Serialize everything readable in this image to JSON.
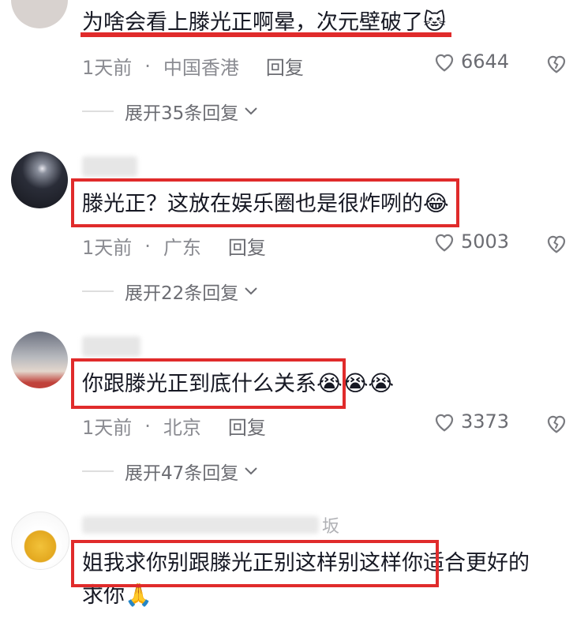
{
  "comments": [
    {
      "text_lines": [
        "为啥会看上滕光正啊晕，次元壁破了"
      ],
      "emoji": "🐱",
      "time": "1天前",
      "location": "中国香港",
      "reply_label": "回复",
      "likes": "6644",
      "expand_label": "展开35条回复"
    },
    {
      "text_lines": [
        "滕光正？这放在娱乐圈也是很炸咧的"
      ],
      "emoji": "😂",
      "time": "1天前",
      "location": "广东",
      "reply_label": "回复",
      "likes": "5003",
      "expand_label": "展开22条回复"
    },
    {
      "text_lines": [
        "你跟滕光正到底什么关系"
      ],
      "emoji": "😭😭😭",
      "time": "1天前",
      "location": "北京",
      "reply_label": "回复",
      "likes": "3373",
      "expand_label": "展开47条回复"
    },
    {
      "username_suffix": "坂",
      "text_lines": [
        "姐我求你别跟滕光正别这样别这样你适合更好的",
        "求你"
      ],
      "emoji": "🙏",
      "time": "",
      "location": "",
      "reply_label": "",
      "likes": "",
      "expand_label": ""
    }
  ],
  "icons": {
    "like": "heart-outline-icon",
    "dislike": "broken-heart-icon",
    "expand": "chevron-down-icon"
  },
  "colors": {
    "highlight": "#e02b2b",
    "meta_text": "#8a8b91"
  }
}
